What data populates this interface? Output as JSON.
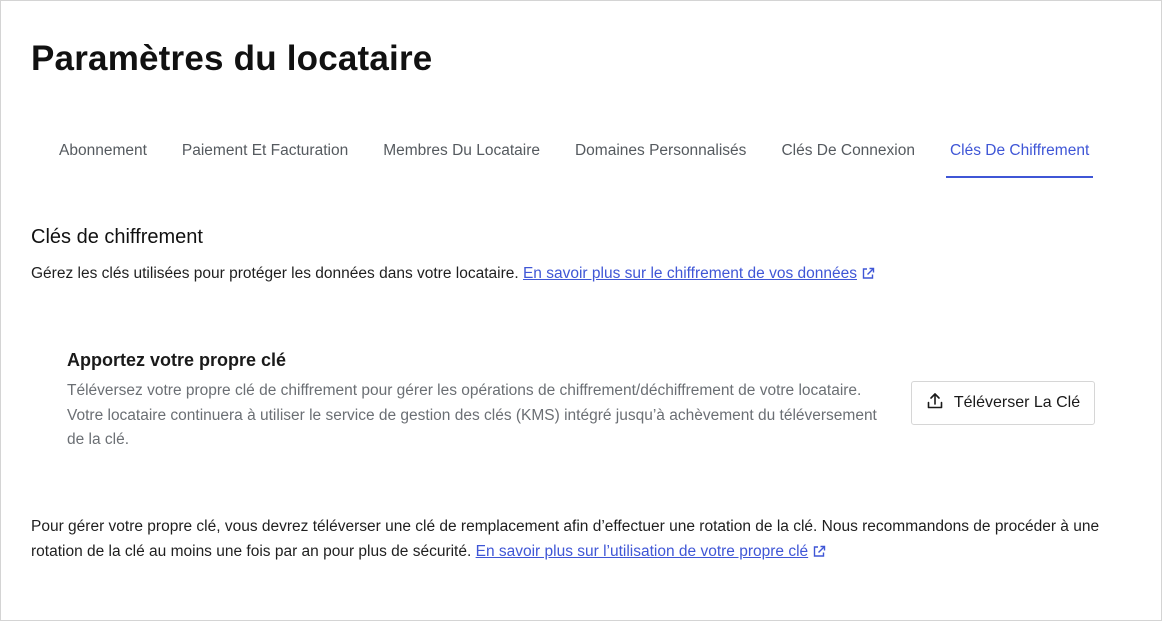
{
  "page": {
    "title": "Paramètres du locataire"
  },
  "tabs": [
    {
      "label": "Abonnement",
      "active": false
    },
    {
      "label": "Paiement Et Facturation",
      "active": false
    },
    {
      "label": "Membres Du Locataire",
      "active": false
    },
    {
      "label": "Domaines Personnalisés",
      "active": false
    },
    {
      "label": "Clés De Connexion",
      "active": false
    },
    {
      "label": "Clés De Chiffrement",
      "active": true
    }
  ],
  "section": {
    "title": "Clés de chiffrement",
    "description": "Gérez les clés utilisées pour protéger les données dans votre locataire.",
    "link_label": "En savoir plus sur le chiffrement de vos données",
    "link_icon": "external-link-icon"
  },
  "byok_card": {
    "title": "Apportez votre propre clé",
    "description": "Téléversez votre propre clé de chiffrement pour gérer les opérations de chiffrement/déchiffrement de votre locataire. Votre locataire continuera à utiliser le service de gestion des clés (KMS) intégré jusqu’à achèvement du téléversement de la clé.",
    "button_label": "Téléverser La Clé",
    "button_icon": "upload-icon"
  },
  "footer": {
    "text": "Pour gérer votre propre clé, vous devrez téléverser une clé de remplacement afin d’effectuer une rotation de la clé. Nous recommandons de procéder à une rotation de la clé au moins une fois par an pour plus de sécurité.",
    "link_label": "En savoir plus sur l’utilisation de votre propre clé",
    "link_icon": "external-link-icon"
  },
  "colors": {
    "accent": "#3f56d6",
    "muted_text": "#6b6f74",
    "border": "#d6d6d6"
  }
}
